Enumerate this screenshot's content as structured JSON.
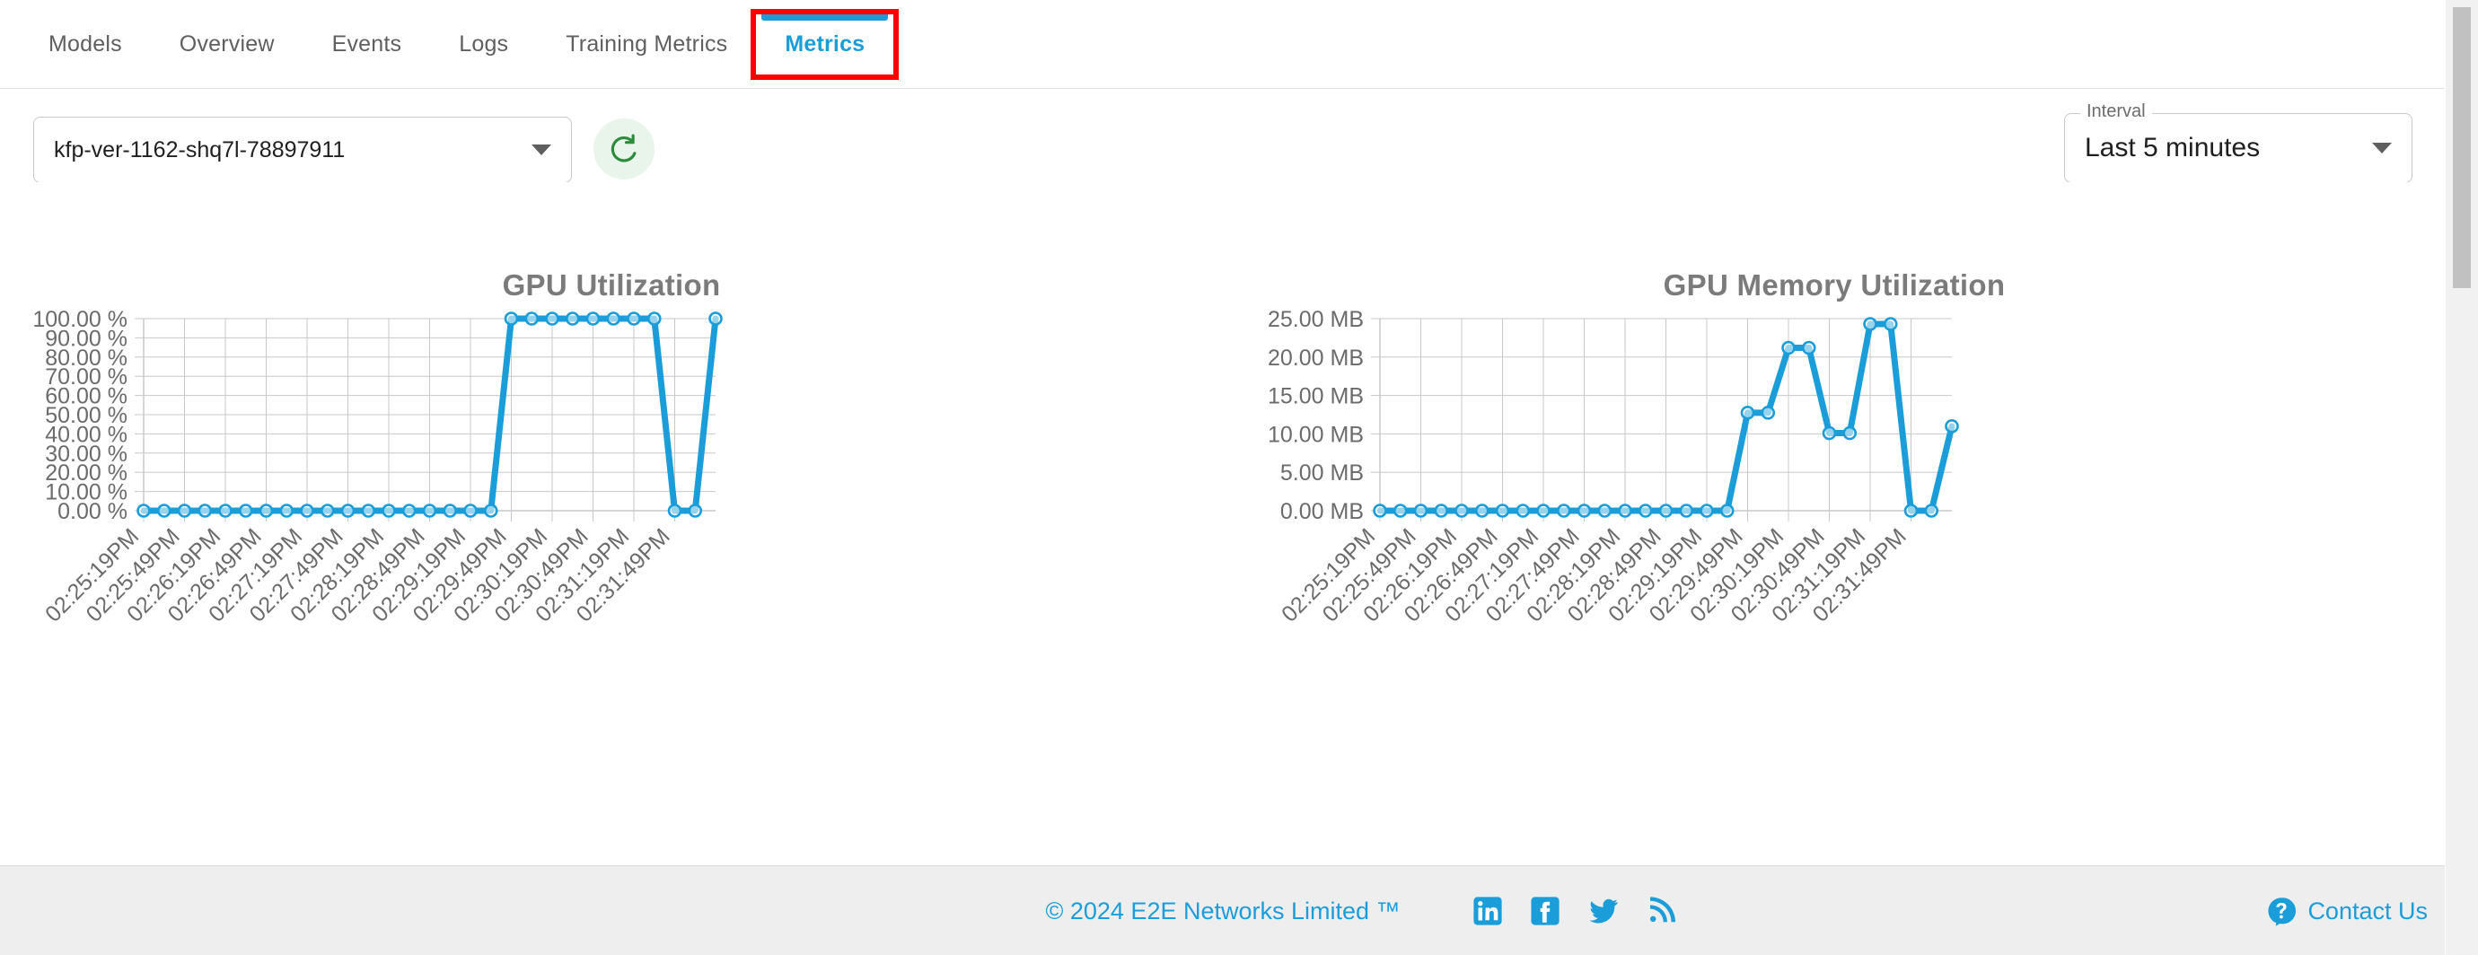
{
  "tabs": [
    {
      "label": "Models",
      "active": false
    },
    {
      "label": "Overview",
      "active": false
    },
    {
      "label": "Events",
      "active": false
    },
    {
      "label": "Logs",
      "active": false
    },
    {
      "label": "Training Metrics",
      "active": false
    },
    {
      "label": "Metrics",
      "active": true
    }
  ],
  "controls": {
    "model_select_value": "kfp-ver-1162-shq7l-78897911",
    "refresh_icon": "refresh-icon",
    "interval_label": "Interval",
    "interval_value": "Last 5 minutes"
  },
  "footer": {
    "copyright": "© 2024 E2E Networks Limited ™",
    "social": [
      "linkedin-icon",
      "facebook-icon",
      "twitter-icon",
      "rss-icon"
    ],
    "contact_label": "Contact Us",
    "contact_icon": "question-mark-icon"
  },
  "colors": {
    "accent": "#1b9dd9",
    "series": "#1b9dd9",
    "annotation": "#ff0000",
    "refresh": "#2e8b3d",
    "grid": "#c8c8c8",
    "title": "#7b7b7b",
    "tick": "#6b6b6b"
  },
  "chart_data": [
    {
      "type": "line",
      "title": "GPU Utilization",
      "xlabel": "",
      "ylabel": "",
      "ylim": [
        0,
        100
      ],
      "yticks": [
        0,
        10,
        20,
        30,
        40,
        50,
        60,
        70,
        80,
        90,
        100
      ],
      "ytick_labels": [
        "0.00 %",
        "10.00 %",
        "20.00 %",
        "30.00 %",
        "40.00 %",
        "50.00 %",
        "60.00 %",
        "70.00 %",
        "80.00 %",
        "90.00 %",
        "100.00 %"
      ],
      "grid": true,
      "legend": "none",
      "xtick_labels": [
        "02:25:19PM",
        "02:25:49PM",
        "02:26:19PM",
        "02:26:49PM",
        "02:27:19PM",
        "02:27:49PM",
        "02:28:19PM",
        "02:28:49PM",
        "02:29:19PM",
        "02:29:49PM",
        "02:30:19PM",
        "02:30:49PM",
        "02:31:19PM",
        "02:31:49PM"
      ],
      "x": [
        0,
        1,
        2,
        3,
        4,
        5,
        6,
        7,
        8,
        9,
        10,
        11,
        12,
        13,
        14,
        15,
        16,
        17,
        18,
        19,
        20,
        21,
        22,
        23,
        24,
        25,
        26
      ],
      "values": [
        0,
        0,
        0,
        0,
        0,
        0,
        0,
        0,
        0,
        0,
        0,
        0,
        0,
        0,
        0,
        0,
        0,
        0,
        100,
        100,
        100,
        100,
        100,
        100,
        100,
        100,
        0,
        0,
        100
      ]
    },
    {
      "type": "line",
      "title": "GPU Memory Utilization",
      "xlabel": "",
      "ylabel": "",
      "ylim": [
        0,
        25
      ],
      "yticks": [
        0,
        5,
        10,
        15,
        20,
        25
      ],
      "ytick_labels": [
        "0.00 MB",
        "5.00 MB",
        "10.00 MB",
        "15.00 MB",
        "20.00 MB",
        "25.00 MB"
      ],
      "grid": true,
      "legend": "none",
      "xtick_labels": [
        "02:25:19PM",
        "02:25:49PM",
        "02:26:19PM",
        "02:26:49PM",
        "02:27:19PM",
        "02:27:49PM",
        "02:28:19PM",
        "02:28:49PM",
        "02:29:19PM",
        "02:29:49PM",
        "02:30:19PM",
        "02:30:49PM",
        "02:31:19PM",
        "02:31:49PM"
      ],
      "x": [
        0,
        1,
        2,
        3,
        4,
        5,
        6,
        7,
        8,
        9,
        10,
        11,
        12,
        13,
        14,
        15,
        16,
        17,
        18,
        19,
        20,
        21,
        22,
        23,
        24,
        25,
        26
      ],
      "values": [
        0,
        0,
        0,
        0,
        0,
        0,
        0,
        0,
        0,
        0,
        0,
        0,
        0,
        0,
        0,
        0,
        0,
        0,
        12.75,
        12.75,
        21.2,
        21.2,
        10.1,
        10.1,
        24.3,
        24.3,
        0,
        0,
        11.0
      ]
    }
  ]
}
